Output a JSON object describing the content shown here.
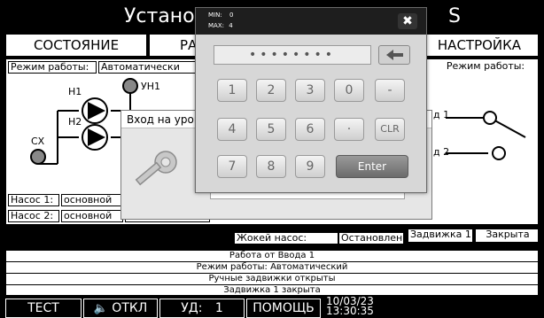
{
  "header": {
    "title_left": "Установк",
    "title_right": "S"
  },
  "tabs": {
    "state": "СОСТОЯНИЕ",
    "middle": "РА",
    "settings": "НАСТРОЙКА"
  },
  "panel": {
    "mode_label": "Режим работы:",
    "mode_value": "Автоматически",
    "mode_label_right": "Режим работы:",
    "pump_h1": "Н1",
    "pump_h2": "Н2",
    "level_uh1": "УН1",
    "sensor_cx": "СХ",
    "input1": "д 1",
    "input2": "д 2",
    "pump1_label": "Насос 1:",
    "pump1_value": "основной",
    "pump2_label": "Насос 2:",
    "pump2_value": "основной",
    "pump2_state": "Остановлен",
    "jockey_label": "Жокей насос:",
    "jockey_value": "Остановлен",
    "valve1_label": "Задвижка 1:",
    "valve1_value": "Закрыта"
  },
  "status_lines": [
    "Работа от Ввода 1",
    "Режим работы: Автоматический",
    "Ручные задвижки открыты",
    "Задвижка 1 закрыта"
  ],
  "toolbar": {
    "test": "ТЕСТ",
    "sound": "ОТКЛ",
    "ud_label": "УД:",
    "ud_value": "1",
    "help": "ПОМОЩЬ",
    "date": "10/03/23",
    "time": "13:30:35"
  },
  "login_dialog": {
    "title": "Вход на уров"
  },
  "keypad": {
    "min_label": "MIN:",
    "min_value": "0",
    "max_label": "MAX:",
    "max_value": "4",
    "display": "••••••••",
    "keys": [
      "1",
      "2",
      "3",
      "0",
      "-",
      "4",
      "5",
      "6",
      "·",
      "CLR",
      "7",
      "8",
      "9"
    ],
    "enter": "Enter"
  }
}
